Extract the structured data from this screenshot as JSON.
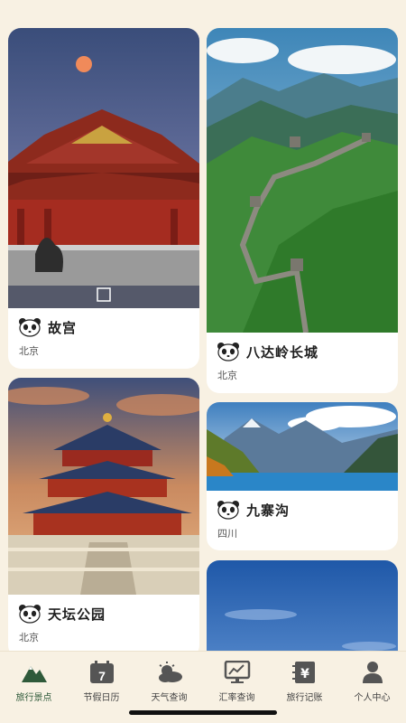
{
  "cards": [
    {
      "title": "故宫",
      "location": "北京"
    },
    {
      "title": "八达岭长城",
      "location": "北京"
    },
    {
      "title": "天坛公园",
      "location": "北京"
    },
    {
      "title": "九寨沟",
      "location": "四川"
    },
    {
      "title": "",
      "location": ""
    }
  ],
  "tabs": [
    {
      "label": "旅行景点",
      "icon": "mountain-icon",
      "active": true
    },
    {
      "label": "节假日历",
      "icon": "calendar-icon",
      "calendar_day": "7"
    },
    {
      "label": "天气查询",
      "icon": "weather-icon"
    },
    {
      "label": "汇率查询",
      "icon": "exchange-chart-icon"
    },
    {
      "label": "旅行记账",
      "icon": "yen-book-icon",
      "symbol": "¥"
    },
    {
      "label": "个人中心",
      "icon": "person-icon"
    }
  ],
  "colors": {
    "background": "#f8f1e3",
    "card": "#ffffff",
    "active_tab": "#2f5a3a",
    "icon": "#555555"
  }
}
